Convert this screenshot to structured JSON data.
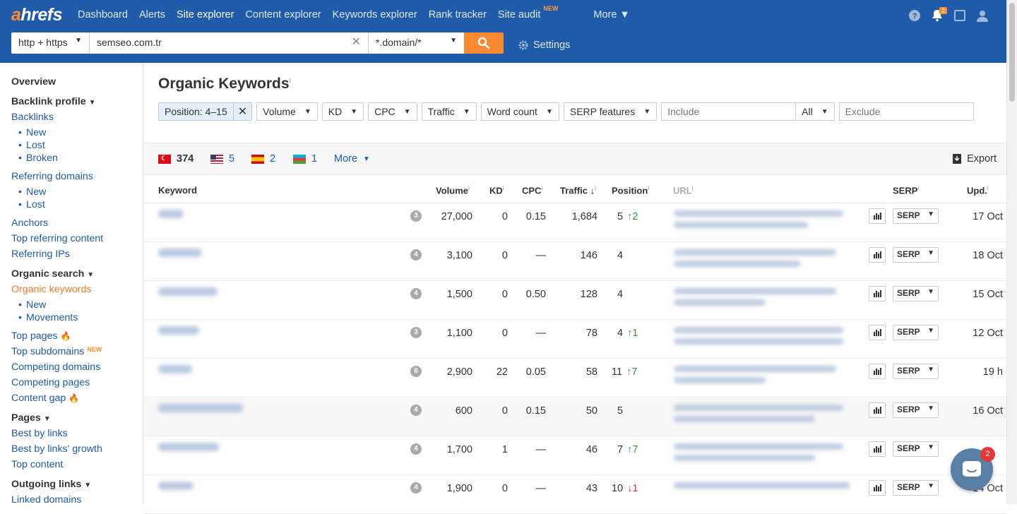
{
  "app": {
    "logo": "ahrefs"
  },
  "nav": [
    {
      "label": "Dashboard",
      "active": false
    },
    {
      "label": "Alerts",
      "active": false
    },
    {
      "label": "Site explorer",
      "active": true
    },
    {
      "label": "Content explorer",
      "active": false
    },
    {
      "label": "Keywords explorer",
      "active": false
    },
    {
      "label": "Rank tracker",
      "active": false
    },
    {
      "label": "Site audit",
      "active": false,
      "tag": "NEW"
    },
    {
      "label": "More",
      "active": false
    }
  ],
  "notifications": {
    "count": "2"
  },
  "search": {
    "protocol": "http + https",
    "domain": "semseo.com.tr",
    "mode": "*.domain/*",
    "settings_label": "Settings"
  },
  "sidebar": {
    "overview": "Overview",
    "backlink_profile": "Backlink profile",
    "backlinks": "Backlinks",
    "bl_new": "New",
    "bl_lost": "Lost",
    "bl_broken": "Broken",
    "referring_domains": "Referring domains",
    "rd_new": "New",
    "rd_lost": "Lost",
    "anchors": "Anchors",
    "top_referring_content": "Top referring content",
    "referring_ips": "Referring IPs",
    "organic_search": "Organic search",
    "organic_keywords": "Organic keywords",
    "ok_new": "New",
    "ok_movements": "Movements",
    "top_pages": "Top pages",
    "top_subdomains": "Top subdomains",
    "top_subdomains_tag": "NEW",
    "competing_domains": "Competing domains",
    "competing_pages": "Competing pages",
    "content_gap": "Content gap",
    "pages": "Pages",
    "best_by_links": "Best by links",
    "best_by_links_growth": "Best by links' growth",
    "top_content": "Top content",
    "outgoing_links": "Outgoing links",
    "linked_domains": "Linked domains"
  },
  "main": {
    "title": "Organic Keywords",
    "info": "i",
    "filters": {
      "position": "Position: 4–15",
      "volume": "Volume",
      "kd": "KD",
      "cpc": "CPC",
      "traffic": "Traffic",
      "word_count": "Word count",
      "serp_features": "SERP features",
      "include_placeholder": "Include",
      "match": "All",
      "exclude_placeholder": "Exclude"
    },
    "countries": [
      {
        "flag": "flag-tr",
        "count": "374"
      },
      {
        "flag": "flag-us",
        "count": "5"
      },
      {
        "flag": "flag-es",
        "count": "2"
      },
      {
        "flag": "flag-az",
        "count": "1"
      }
    ],
    "more_label": "More",
    "export_label": "Export",
    "columns": {
      "keyword": "Keyword",
      "volume": "Volume",
      "kd": "KD",
      "cpc": "CPC",
      "traffic": "Traffic",
      "position": "Position",
      "url": "URL",
      "serp": "SERP",
      "upd": "Upd."
    },
    "rows": [
      {
        "kd_badge": "3",
        "volume": "27,000",
        "kd": "0",
        "cpc": "0.15",
        "traffic": "1,684",
        "position": "5",
        "change": "2",
        "dir": "up",
        "serp": "SERP",
        "upd": "17 Oct"
      },
      {
        "kd_badge": "4",
        "volume": "3,100",
        "kd": "0",
        "cpc": "—",
        "traffic": "146",
        "position": "4",
        "change": "",
        "dir": "",
        "serp": "SERP",
        "upd": "18 Oct"
      },
      {
        "kd_badge": "4",
        "volume": "1,500",
        "kd": "0",
        "cpc": "0.50",
        "traffic": "128",
        "position": "4",
        "change": "",
        "dir": "",
        "serp": "SERP",
        "upd": "15 Oct"
      },
      {
        "kd_badge": "3",
        "volume": "1,100",
        "kd": "0",
        "cpc": "—",
        "traffic": "78",
        "position": "4",
        "change": "1",
        "dir": "up",
        "serp": "SERP",
        "upd": "12 Oct"
      },
      {
        "kd_badge": "6",
        "volume": "2,900",
        "kd": "22",
        "cpc": "0.05",
        "traffic": "58",
        "position": "11",
        "change": "7",
        "dir": "up",
        "serp": "SERP",
        "upd": "19 h"
      },
      {
        "kd_badge": "4",
        "volume": "600",
        "kd": "0",
        "cpc": "0.15",
        "traffic": "50",
        "position": "5",
        "change": "",
        "dir": "",
        "serp": "SERP",
        "upd": "16 Oct"
      },
      {
        "kd_badge": "4",
        "volume": "1,700",
        "kd": "1",
        "cpc": "—",
        "traffic": "46",
        "position": "7",
        "change": "7",
        "dir": "up",
        "serp": "SERP",
        "upd": ""
      },
      {
        "kd_badge": "4",
        "volume": "1,900",
        "kd": "0",
        "cpc": "—",
        "traffic": "43",
        "position": "10",
        "change": "1",
        "dir": "down",
        "serp": "SERP",
        "upd": "14 Oct"
      }
    ]
  },
  "chat": {
    "badge": "2"
  }
}
